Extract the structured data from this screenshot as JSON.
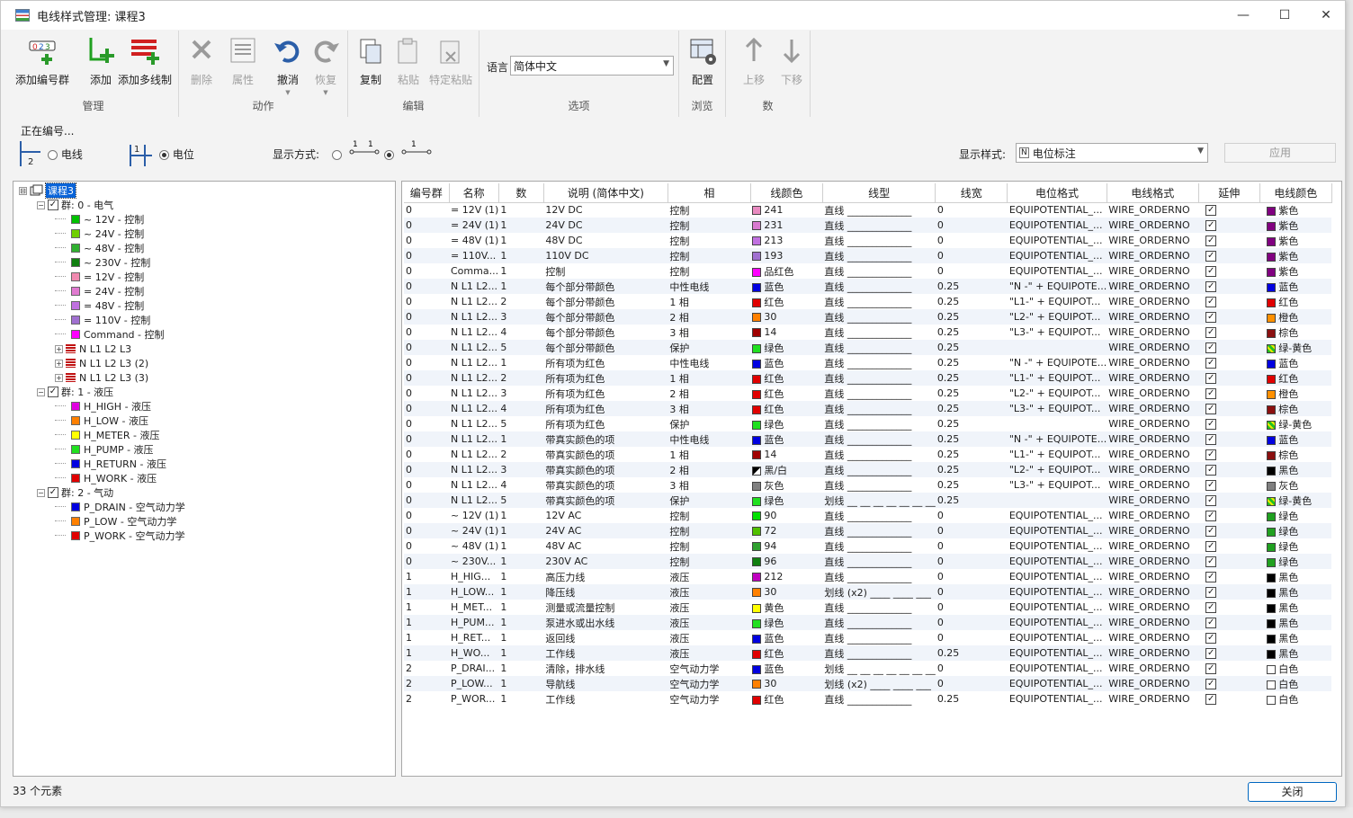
{
  "window": {
    "title": "电线样式管理: 课程3",
    "minimize": "—",
    "maximize": "☐",
    "close": "✕"
  },
  "ribbon": {
    "groups": [
      {
        "label": "管理",
        "buttons": [
          "添加编号群",
          "添加",
          "添加多线制"
        ]
      },
      {
        "label": "动作",
        "buttons": [
          "删除",
          "属性",
          "撤消",
          "恢复"
        ]
      },
      {
        "label": "编辑",
        "buttons": [
          "复制",
          "粘贴",
          "特定粘贴"
        ]
      },
      {
        "label": "选项",
        "language_label": "语言",
        "language_value": "简体中文"
      },
      {
        "label": "浏览",
        "buttons": [
          "配置"
        ]
      },
      {
        "label": "数",
        "buttons": [
          "上移",
          "下移"
        ]
      }
    ],
    "dim_labels": {
      "delete": "删除",
      "props": "属性",
      "undo": "撤消",
      "redo": "恢复"
    }
  },
  "editbar": {
    "numbering_label": "正在编号...",
    "opt_wire": "电线",
    "opt_potential": "电位",
    "display_mode_label": "显示方式:",
    "display_style_label": "显示样式:",
    "display_style_value": "电位标注",
    "apply": "应用"
  },
  "tree": {
    "root": "课程3",
    "rows": [
      {
        "lv": 1,
        "exp": "⊟",
        "chk": true,
        "text": "群: 0 - 电气"
      },
      {
        "lv": 2,
        "color": "#00c000",
        "text": "~  12V - 控制"
      },
      {
        "lv": 2,
        "color": "#70d000",
        "text": "~  24V - 控制"
      },
      {
        "lv": 2,
        "color": "#30b030",
        "text": "~  48V - 控制"
      },
      {
        "lv": 2,
        "color": "#108010",
        "text": "~ 230V - 控制"
      },
      {
        "lv": 2,
        "color": "#f08ab0",
        "text": "=  12V - 控制"
      },
      {
        "lv": 2,
        "color": "#e07ad0",
        "text": "=  24V - 控制"
      },
      {
        "lv": 2,
        "color": "#c070e0",
        "text": "=  48V - 控制"
      },
      {
        "lv": 2,
        "color": "#a070d0",
        "text": "= 110V - 控制"
      },
      {
        "lv": 2,
        "color": "#ff00ff",
        "text": "Command - 控制"
      },
      {
        "lv": 2,
        "exp": "⊞",
        "multi": true,
        "text": "N L1 L2 L3"
      },
      {
        "lv": 2,
        "exp": "⊞",
        "multi": true,
        "text": "N L1 L2 L3 (2)"
      },
      {
        "lv": 2,
        "exp": "⊞",
        "multi": true,
        "text": "N L1 L2 L3 (3)"
      },
      {
        "lv": 1,
        "exp": "⊟",
        "chk": true,
        "text": "群: 1 - 液压"
      },
      {
        "lv": 2,
        "color": "#e000e0",
        "text": "H_HIGH - 液压"
      },
      {
        "lv": 2,
        "color": "#ff8000",
        "text": "H_LOW - 液压"
      },
      {
        "lv": 2,
        "color": "#ffff00",
        "text": "H_METER - 液压"
      },
      {
        "lv": 2,
        "color": "#20e020",
        "text": "H_PUMP - 液压"
      },
      {
        "lv": 2,
        "color": "#0000e0",
        "text": "H_RETURN - 液压"
      },
      {
        "lv": 2,
        "color": "#e00000",
        "text": "H_WORK - 液压"
      },
      {
        "lv": 1,
        "exp": "⊟",
        "chk": true,
        "text": "群: 2 - 气动"
      },
      {
        "lv": 2,
        "color": "#0000e0",
        "text": "P_DRAIN - 空气动力学"
      },
      {
        "lv": 2,
        "color": "#ff8000",
        "text": "P_LOW - 空气动力学"
      },
      {
        "lv": 2,
        "color": "#e00000",
        "text": "P_WORK - 空气动力学"
      }
    ]
  },
  "grid": {
    "columns": [
      "编号群",
      "名称",
      "数",
      "说明 (简体中文)",
      "相",
      "线颜色",
      "线型",
      "线宽",
      "电位格式",
      "电线格式",
      "延伸",
      "电线颜色"
    ],
    "rows": [
      [
        "0",
        "=  12V (1)",
        "1",
        "12V DC",
        "控制",
        "#e88ac0",
        "241",
        "直线 _____________",
        "0",
        "EQUIPOTENTIAL_...",
        "WIRE_ORDERNO",
        "#800080",
        "紫色"
      ],
      [
        "0",
        "=  24V (1)",
        "1",
        "24V DC",
        "控制",
        "#d87ad0",
        "231",
        "直线 _____________",
        "0",
        "EQUIPOTENTIAL_...",
        "WIRE_ORDERNO",
        "#800080",
        "紫色"
      ],
      [
        "0",
        "=  48V (1)",
        "1",
        "48V DC",
        "控制",
        "#c070e0",
        "213",
        "直线 _____________",
        "0",
        "EQUIPOTENTIAL_...",
        "WIRE_ORDERNO",
        "#800080",
        "紫色"
      ],
      [
        "0",
        "= 110V...",
        "1",
        "110V DC",
        "控制",
        "#a070d0",
        "193",
        "直线 _____________",
        "0",
        "EQUIPOTENTIAL_...",
        "WIRE_ORDERNO",
        "#800080",
        "紫色"
      ],
      [
        "0",
        "Comma...",
        "1",
        "控制",
        "控制",
        "#ff00ff",
        "品红色",
        "直线 _____________",
        "0",
        "EQUIPOTENTIAL_...",
        "WIRE_ORDERNO",
        "#800080",
        "紫色"
      ],
      [
        "0",
        "N L1 L2...",
        "1",
        "每个部分带颜色",
        "中性电线",
        "#0000e0",
        "蓝色",
        "直线 _____________",
        "0.25",
        "\"N -\" + EQUIPOTE...",
        "WIRE_ORDERNO",
        "#0000e0",
        "蓝色"
      ],
      [
        "0",
        "N L1 L2...",
        "2",
        "每个部分带颜色",
        "1 相",
        "#e00000",
        "红色",
        "直线 _____________",
        "0.25",
        "\"L1-\" + EQUIPOT...",
        "WIRE_ORDERNO",
        "#e00000",
        "红色"
      ],
      [
        "0",
        "N L1 L2...",
        "3",
        "每个部分带颜色",
        "2 相",
        "#ff8000",
        "30",
        "直线 _____________",
        "0.25",
        "\"L2-\" + EQUIPOT...",
        "WIRE_ORDERNO",
        "#ff9000",
        "橙色"
      ],
      [
        "0",
        "N L1 L2...",
        "4",
        "每个部分带颜色",
        "3 相",
        "#a00000",
        "14",
        "直线 _____________",
        "0.25",
        "\"L3-\" + EQUIPOT...",
        "WIRE_ORDERNO",
        "#8b1010",
        "棕色"
      ],
      [
        "0",
        "N L1 L2...",
        "5",
        "每个部分带颜色",
        "保护",
        "#20e020",
        "绿色",
        "直线 _____________",
        "0.25",
        "",
        "WIRE_ORDERNO",
        "GY",
        "绿-黄色"
      ],
      [
        "0",
        "N L1 L2...",
        "1",
        "所有项为红色",
        "中性电线",
        "#0000e0",
        "蓝色",
        "直线 _____________",
        "0.25",
        "\"N -\" + EQUIPOTE...",
        "WIRE_ORDERNO",
        "#0000e0",
        "蓝色"
      ],
      [
        "0",
        "N L1 L2...",
        "2",
        "所有项为红色",
        "1 相",
        "#e00000",
        "红色",
        "直线 _____________",
        "0.25",
        "\"L1-\" + EQUIPOT...",
        "WIRE_ORDERNO",
        "#e00000",
        "红色"
      ],
      [
        "0",
        "N L1 L2...",
        "3",
        "所有项为红色",
        "2 相",
        "#e00000",
        "红色",
        "直线 _____________",
        "0.25",
        "\"L2-\" + EQUIPOT...",
        "WIRE_ORDERNO",
        "#ff9000",
        "橙色"
      ],
      [
        "0",
        "N L1 L2...",
        "4",
        "所有项为红色",
        "3 相",
        "#e00000",
        "红色",
        "直线 _____________",
        "0.25",
        "\"L3-\" + EQUIPOT...",
        "WIRE_ORDERNO",
        "#8b1010",
        "棕色"
      ],
      [
        "0",
        "N L1 L2...",
        "5",
        "所有项为红色",
        "保护",
        "#20e020",
        "绿色",
        "直线 _____________",
        "0.25",
        "",
        "WIRE_ORDERNO",
        "GY",
        "绿-黄色"
      ],
      [
        "0",
        "N L1 L2...",
        "1",
        "带真实颜色的项",
        "中性电线",
        "#0000e0",
        "蓝色",
        "直线 _____________",
        "0.25",
        "\"N -\" + EQUIPOTE...",
        "WIRE_ORDERNO",
        "#0000e0",
        "蓝色"
      ],
      [
        "0",
        "N L1 L2...",
        "2",
        "带真实颜色的项",
        "1 相",
        "#a00000",
        "14",
        "直线 _____________",
        "0.25",
        "\"L1-\" + EQUIPOT...",
        "WIRE_ORDERNO",
        "#8b1010",
        "棕色"
      ],
      [
        "0",
        "N L1 L2...",
        "3",
        "带真实颜色的项",
        "2 相",
        "BW",
        "黑/白",
        "直线 _____________",
        "0.25",
        "\"L2-\" + EQUIPOT...",
        "WIRE_ORDERNO",
        "#000000",
        "黑色"
      ],
      [
        "0",
        "N L1 L2...",
        "4",
        "带真实颜色的项",
        "3 相",
        "#808080",
        "灰色",
        "直线 _____________",
        "0.25",
        "\"L3-\" + EQUIPOT...",
        "WIRE_ORDERNO",
        "#808080",
        "灰色"
      ],
      [
        "0",
        "N L1 L2...",
        "5",
        "带真实颜色的项",
        "保护",
        "#20e020",
        "绿色",
        "划线 __ __ __ __ __ __ __",
        "0.25",
        "",
        "WIRE_ORDERNO",
        "GY",
        "绿-黄色"
      ],
      [
        "0",
        "~  12V (1)",
        "1",
        "12V AC",
        "控制",
        "#00e000",
        "90",
        "直线 _____________",
        "0",
        "EQUIPOTENTIAL_...",
        "WIRE_ORDERNO",
        "#20a020",
        "绿色"
      ],
      [
        "0",
        "~  24V (1)",
        "1",
        "24V AC",
        "控制",
        "#50c000",
        "72",
        "直线 _____________",
        "0",
        "EQUIPOTENTIAL_...",
        "WIRE_ORDERNO",
        "#20a020",
        "绿色"
      ],
      [
        "0",
        "~  48V (1)",
        "1",
        "48V AC",
        "控制",
        "#30a030",
        "94",
        "直线 _____________",
        "0",
        "EQUIPOTENTIAL_...",
        "WIRE_ORDERNO",
        "#20a020",
        "绿色"
      ],
      [
        "0",
        "~ 230V...",
        "1",
        "230V AC",
        "控制",
        "#108010",
        "96",
        "直线 _____________",
        "0",
        "EQUIPOTENTIAL_...",
        "WIRE_ORDERNO",
        "#20a020",
        "绿色"
      ],
      [
        "1",
        "H_HIG...",
        "1",
        "高压力线",
        "液压",
        "#c000c0",
        "212",
        "直线 _____________",
        "0",
        "EQUIPOTENTIAL_...",
        "WIRE_ORDERNO",
        "#000000",
        "黑色"
      ],
      [
        "1",
        "H_LOW...",
        "1",
        "降压线",
        "液压",
        "#ff8000",
        "30",
        "划线 (x2) ____ ____ ___",
        "0",
        "EQUIPOTENTIAL_...",
        "WIRE_ORDERNO",
        "#000000",
        "黑色"
      ],
      [
        "1",
        "H_MET...",
        "1",
        "测量或流量控制",
        "液压",
        "#ffff00",
        "黄色",
        "直线 _____________",
        "0",
        "EQUIPOTENTIAL_...",
        "WIRE_ORDERNO",
        "#000000",
        "黑色"
      ],
      [
        "1",
        "H_PUM...",
        "1",
        "泵进水或出水线",
        "液压",
        "#20e020",
        "绿色",
        "直线 _____________",
        "0",
        "EQUIPOTENTIAL_...",
        "WIRE_ORDERNO",
        "#000000",
        "黑色"
      ],
      [
        "1",
        "H_RET...",
        "1",
        "返回线",
        "液压",
        "#0000e0",
        "蓝色",
        "直线 _____________",
        "0",
        "EQUIPOTENTIAL_...",
        "WIRE_ORDERNO",
        "#000000",
        "黑色"
      ],
      [
        "1",
        "H_WO...",
        "1",
        "工作线",
        "液压",
        "#e00000",
        "红色",
        "直线 _____________",
        "0.25",
        "EQUIPOTENTIAL_...",
        "WIRE_ORDERNO",
        "#000000",
        "黑色"
      ],
      [
        "2",
        "P_DRAI...",
        "1",
        "清除，排水线",
        "空气动力学",
        "#0000e0",
        "蓝色",
        "划线 __ __ __ __ __ __ __",
        "0",
        "EQUIPOTENTIAL_...",
        "WIRE_ORDERNO",
        "#ffffff",
        "白色"
      ],
      [
        "2",
        "P_LOW...",
        "1",
        "导航线",
        "空气动力学",
        "#ff8000",
        "30",
        "划线 (x2) ____ ____ ___",
        "0",
        "EQUIPOTENTIAL_...",
        "WIRE_ORDERNO",
        "#ffffff",
        "白色"
      ],
      [
        "2",
        "P_WOR...",
        "1",
        "工作线",
        "空气动力学",
        "#e00000",
        "红色",
        "直线 _____________",
        "0.25",
        "EQUIPOTENTIAL_...",
        "WIRE_ORDERNO",
        "#ffffff",
        "白色"
      ]
    ]
  },
  "status": {
    "count": "33 个元素",
    "close": "关闭"
  }
}
